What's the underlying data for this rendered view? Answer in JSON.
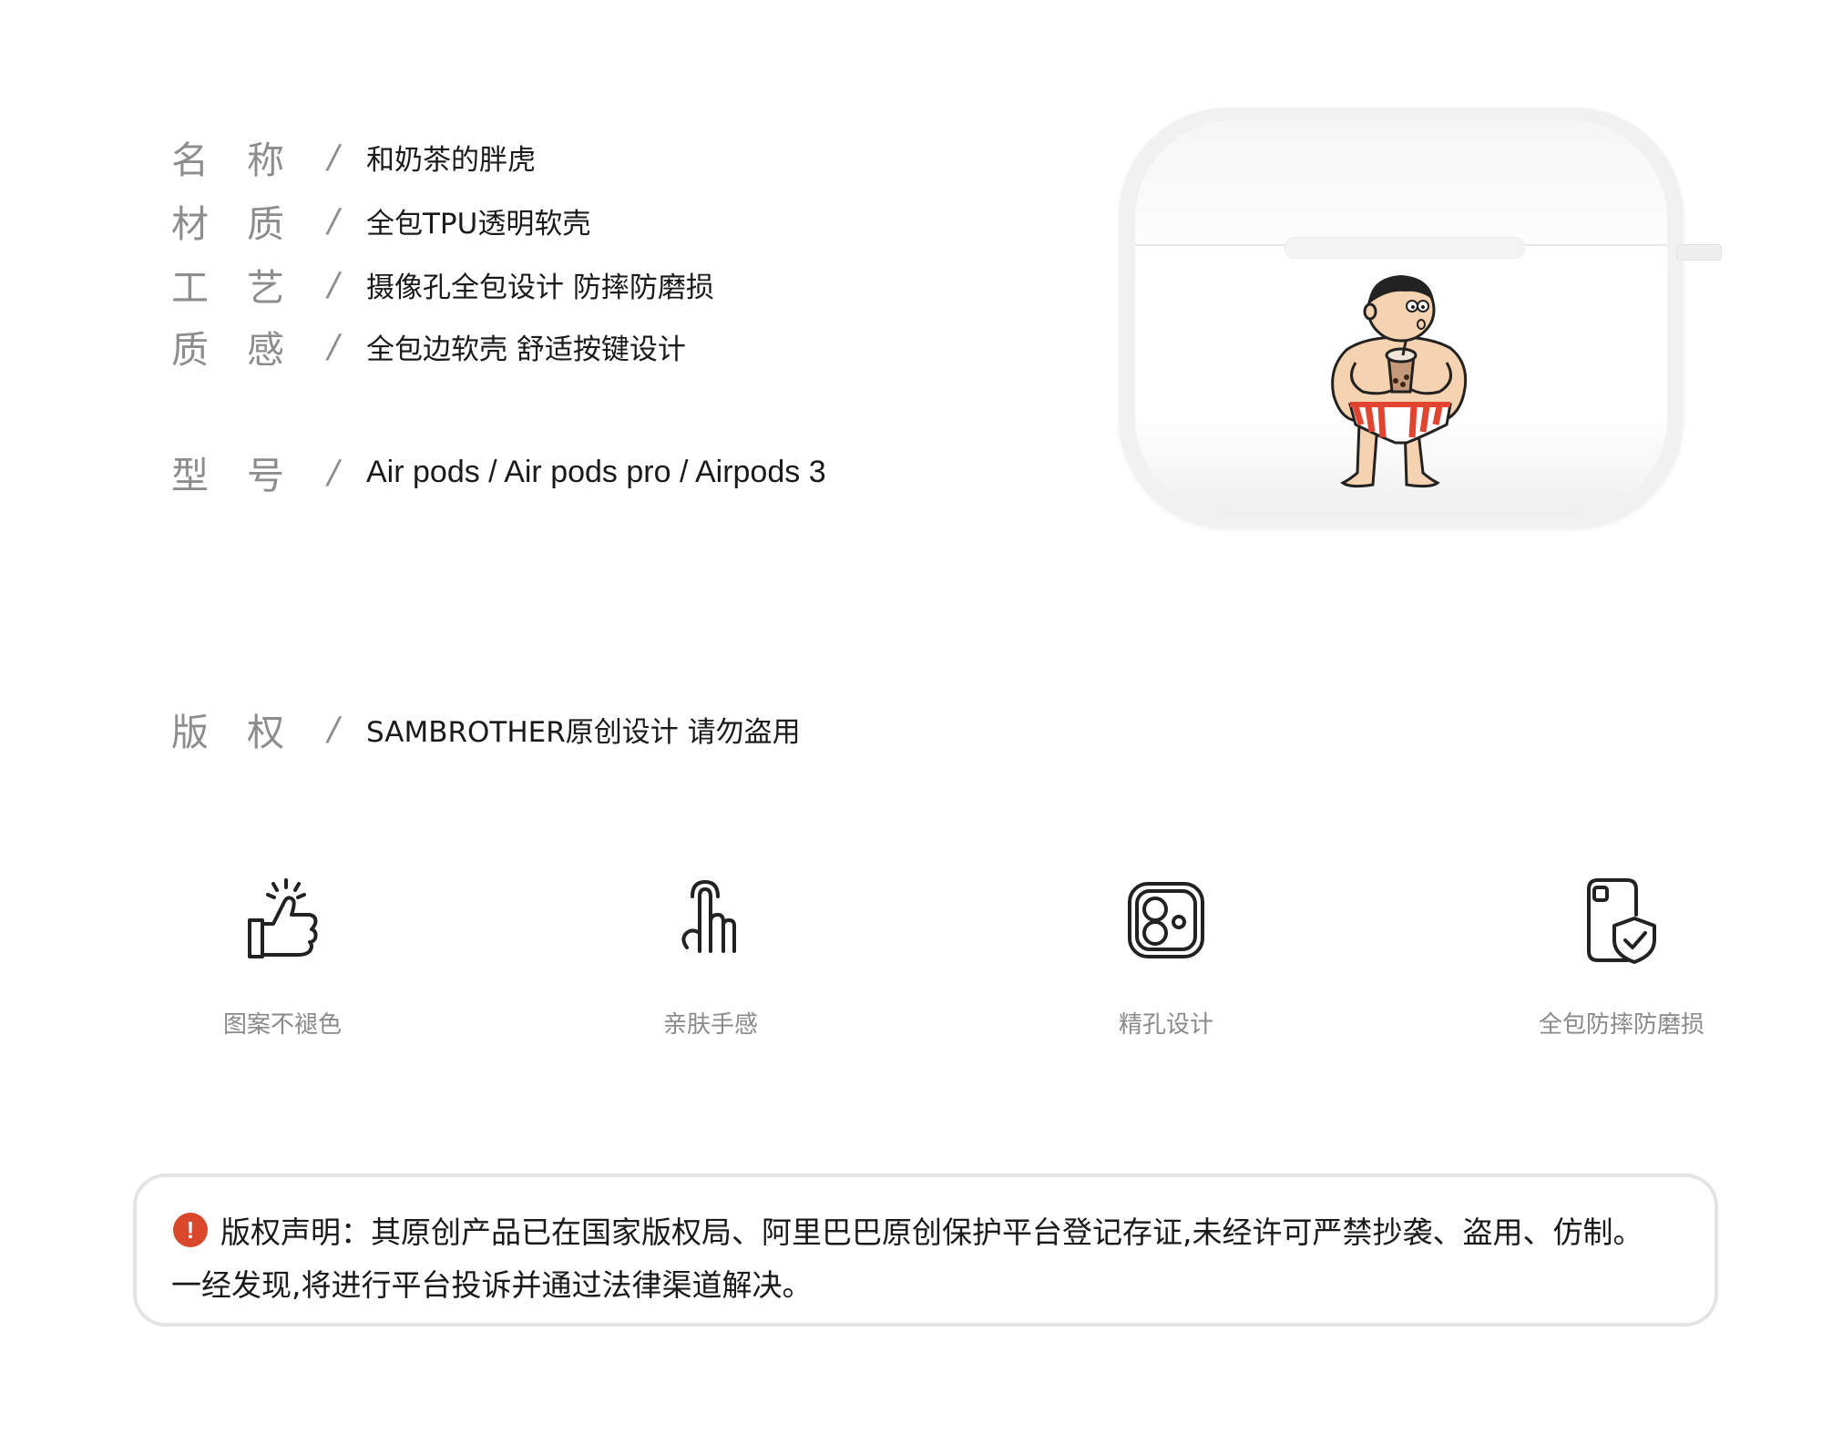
{
  "specs": [
    {
      "label_a": "名",
      "label_b": "称",
      "slash": "/",
      "value": "和奶茶的胖虎"
    },
    {
      "label_a": "材",
      "label_b": "质",
      "slash": "/",
      "value": "全包TPU透明软壳"
    },
    {
      "label_a": "工",
      "label_b": "艺",
      "slash": "/",
      "value": "摄像孔全包设计 防摔防磨损"
    },
    {
      "label_a": "质",
      "label_b": "感",
      "slash": "/",
      "value": "全包边软壳  舒适按键设计"
    },
    {
      "label_a": "型",
      "label_b": "号",
      "slash": "/",
      "value": "Air pods / Air pods pro / Airpods 3"
    },
    {
      "label_a": "版",
      "label_b": "权",
      "slash": "/",
      "value": "SAMBROTHER原创设计  请勿盗用"
    }
  ],
  "features": [
    {
      "label": "图案不褪色",
      "icon": "thumbs-up-icon"
    },
    {
      "label": "亲肤手感",
      "icon": "finger-touch-icon"
    },
    {
      "label": "精孔设计",
      "icon": "camera-hole-icon"
    },
    {
      "label": "全包防摔防磨损",
      "icon": "phone-shield-icon"
    }
  ],
  "notice": {
    "icon_glyph": "!",
    "line1": "版权声明：其原创产品已在国家版权局、阿里巴巴原创保护平台登记存证,未经许可严禁抄袭、盗用、仿制。",
    "line2": "一经发现,将进行平台投诉并通过法律渠道解决。"
  },
  "colors": {
    "label_gray": "#8d8d8d",
    "text_dark": "#1a1a1a",
    "warning_red": "#d9482b",
    "swim_red": "#e2452f"
  }
}
